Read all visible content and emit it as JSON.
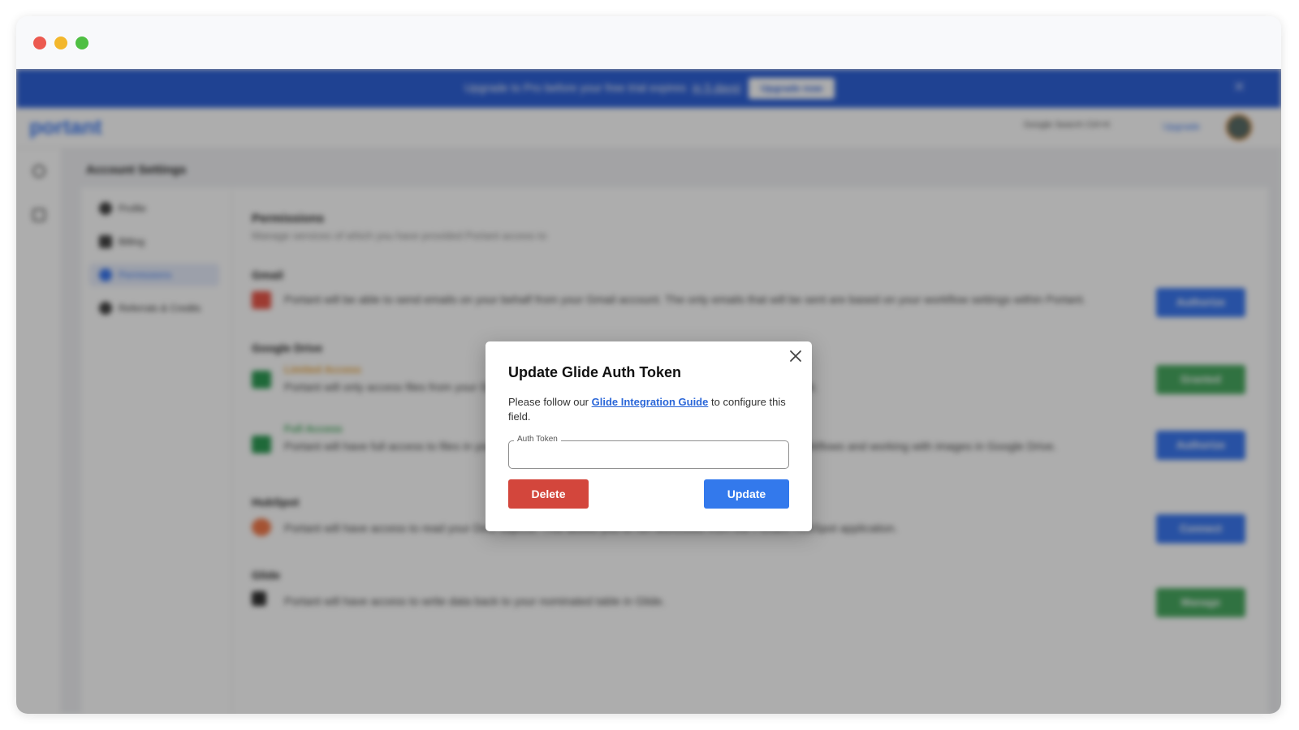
{
  "window": {
    "controls": [
      "close",
      "minimize",
      "zoom"
    ]
  },
  "banner": {
    "text": "Upgrade to Pro before your free trial expires",
    "link": "in 5 days!",
    "button": "Upgrade now",
    "close_icon": "close-icon"
  },
  "topbar": {
    "logo": "portant",
    "search_placeholder": "Google Search Ctrl+K",
    "upgrade_link": "Upgrade"
  },
  "page": {
    "title": "Account Settings"
  },
  "settings_nav": [
    {
      "label": "Profile",
      "icon": "user-icon"
    },
    {
      "label": "Billing",
      "icon": "card-icon"
    },
    {
      "label": "Permissions",
      "icon": "shield-icon",
      "active": true
    },
    {
      "label": "Referrals & Credits",
      "icon": "gift-icon"
    }
  ],
  "permissions": {
    "title": "Permissions",
    "subtitle": "Manage services of which you have provided Portant access to",
    "sections": [
      {
        "title": "Gmail",
        "text": "Portant will be able to send emails on your behalf from your Gmail account. The only emails that will be sent are based on your workflow settings within Portant.",
        "button": "Authorize"
      },
      {
        "title": "Google Drive",
        "label": "Limited Access",
        "text": "Portant will only access files from your Google Drive that you have selected or that are created by Portant.",
        "button": "Granted"
      },
      {
        "label": "Full Access",
        "text": "Portant will have full access to files in your Google Drive. This is required for features such as shared workflows and working with images in Google Drive.",
        "button": "Authorize"
      },
      {
        "title": "HubSpot",
        "text": "Portant will have access to read your Deal objects. This allows you to run workflows from the Portant HubSpot application.",
        "button": "Connect"
      },
      {
        "title": "Glide",
        "text": "Portant will have access to write data back to your nominated table in Glide.",
        "button": "Manage"
      }
    ]
  },
  "modal": {
    "title": "Update Glide Auth Token",
    "desc_before": "Please follow our",
    "desc_link": "Glide Integration Guide",
    "desc_after": "to configure this field.",
    "field_label": "Auth Token",
    "field_value": "",
    "delete_label": "Delete",
    "update_label": "Update"
  },
  "colors": {
    "banner": "#2f62d8",
    "primary": "#3379ec",
    "danger": "#d3463c",
    "success": "#48a960",
    "link": "#2a66d8"
  }
}
